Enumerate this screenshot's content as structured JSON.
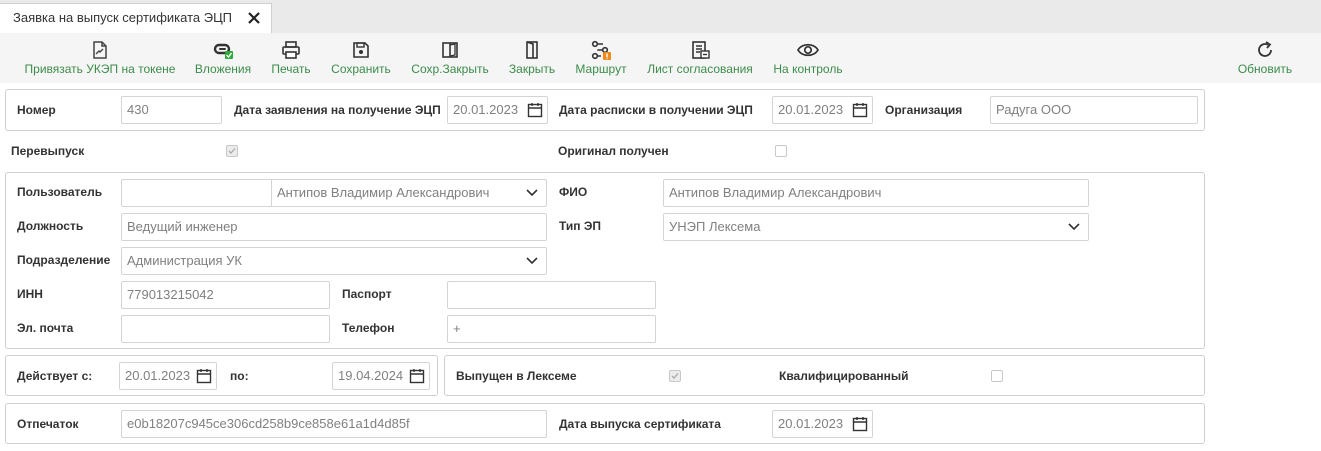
{
  "tab": {
    "title": "Заявка на выпуск сертификата ЭЦП"
  },
  "toolbar": {
    "bind_key": "Привязать УКЭП на токене",
    "attachments": "Вложения",
    "print": "Печать",
    "save": "Сохранить",
    "save_close": "Сохр.Закрыть",
    "close": "Закрыть",
    "route": "Маршрут",
    "approval_sheet": "Лист согласования",
    "control": "На контроль",
    "refresh": "Обновить"
  },
  "header": {
    "number_label": "Номер",
    "number": "430",
    "app_date_label": "Дата заявления на получение ЭЦП",
    "app_date": "20.01.2023",
    "receipt_date_label": "Дата расписки в получении ЭЦП",
    "receipt_date": "20.01.2023",
    "org_label": "Организация",
    "org": "Радуга ООО"
  },
  "flags": {
    "reissue_label": "Перевыпуск",
    "reissue": true,
    "original_label": "Оригинал получен",
    "original": false
  },
  "user": {
    "user_label": "Пользователь",
    "user": "Антипов Владимир Александрович",
    "fio_label": "ФИО",
    "fio": "Антипов Владимир Александрович",
    "position_label": "Должность",
    "position": "Ведущий инженер",
    "sign_type_label": "Тип ЭП",
    "sign_type": "УНЭП Лексема",
    "department_label": "Подразделение",
    "department": "Администрация УК",
    "inn_label": "ИНН",
    "inn": "779013215042",
    "passport_label": "Паспорт",
    "passport": "",
    "email_label": "Эл. почта",
    "email": "",
    "phone_label": "Телефон",
    "phone": "+"
  },
  "validity": {
    "from_label": "Действует с:",
    "from": "20.01.2023",
    "to_label": "по:",
    "to": "19.04.2024",
    "issued_label": "Выпущен в Лексеме",
    "issued": true,
    "qualified_label": "Квалифицированный",
    "qualified": false
  },
  "cert": {
    "thumbprint_label": "Отпечаток",
    "thumbprint": "e0b18207c945ce306cd258b9ce858e61a1d4d85f",
    "issue_date_label": "Дата выпуска сертификата",
    "issue_date": "20.01.2023"
  },
  "colors": {
    "accent": "#3c8c4a",
    "badge_orange": "#f08a1c",
    "badge_green": "#2daa3c"
  }
}
